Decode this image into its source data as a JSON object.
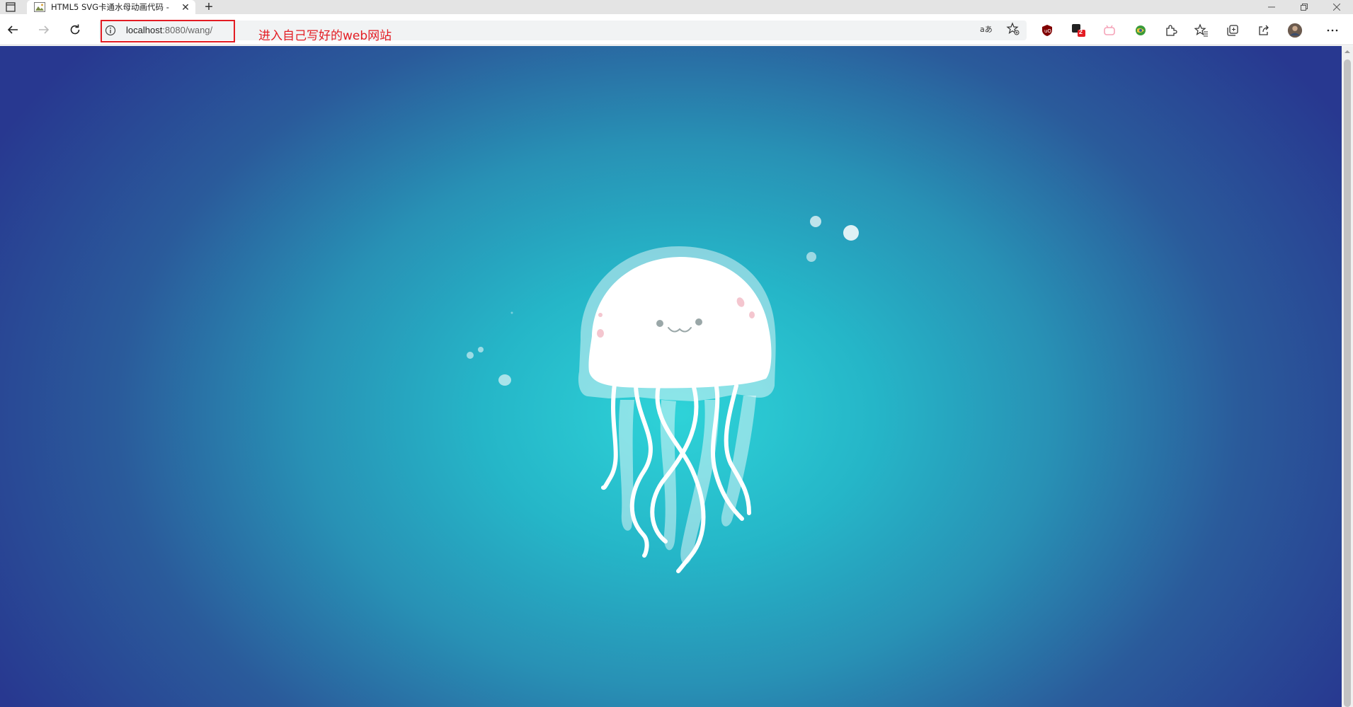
{
  "tab": {
    "title": "HTML5 SVG卡通水母动画代码 - ",
    "close_glyph": "✕"
  },
  "new_tab_glyph": "+",
  "window": {
    "minimize": "—",
    "restore": "❐",
    "close": "✕"
  },
  "address": {
    "host": "localhost",
    "path": ":8080/wang/"
  },
  "annotation": "进入自己写好的web网站",
  "toolbar_icons": [
    "translate-icon",
    "favorite-add-icon",
    "ublock-extension-icon",
    "extension-badge-icon",
    "bilibili-extension-icon",
    "globe-extension-icon",
    "extensions-icon",
    "favorites-icon",
    "collections-icon",
    "share-icon",
    "profile-avatar",
    "more-menu-icon"
  ],
  "extension_badge": "2",
  "colors": {
    "annotation_red": "#e31c23",
    "ocean_center": "#2ed3d8",
    "ocean_edge": "#283890"
  }
}
